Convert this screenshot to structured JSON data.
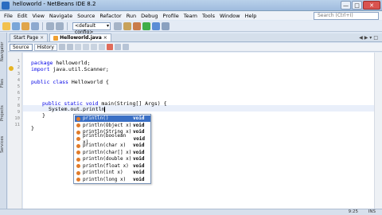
{
  "window": {
    "title": "helloworld - NetBeans IDE 8.2"
  },
  "menu": [
    "File",
    "Edit",
    "View",
    "Navigate",
    "Source",
    "Refactor",
    "Run",
    "Debug",
    "Profile",
    "Team",
    "Tools",
    "Window",
    "Help"
  ],
  "search": {
    "placeholder": "Search (Ctrl+I)"
  },
  "toolbar": {
    "config": "<default config>"
  },
  "side_tabs": [
    "Navigator",
    "Files",
    "Projects",
    "Services"
  ],
  "tabs": [
    {
      "label": "Start Page"
    },
    {
      "label": "Helloworld.java",
      "active": true
    }
  ],
  "source_bar": {
    "source": "Source",
    "history": "History"
  },
  "line_numbers": [
    "1",
    "2",
    "3",
    "4",
    "5",
    "6",
    "7",
    "8",
    "9",
    "10",
    "11"
  ],
  "code": {
    "line1_kw": "package",
    "line1_rest": " helloworld;",
    "line2_kw": "import",
    "line2_rest": " java.util.Scanner;",
    "line3_kw": "public class",
    "line3_rest": " Helloworld {",
    "line4_kw": "public static void",
    "line4_rest": " main(String[] Args) {",
    "line5": "System.out.println",
    "line6": "}",
    "line7": "}"
  },
  "completion": [
    {
      "sig": "println()",
      "type": "void"
    },
    {
      "sig": "println(Object x)",
      "type": "void"
    },
    {
      "sig": "println(String x)",
      "type": "void"
    },
    {
      "sig": "println(boolean x)",
      "type": "void"
    },
    {
      "sig": "println(char x)",
      "type": "void"
    },
    {
      "sig": "println(char[] x)",
      "type": "void"
    },
    {
      "sig": "println(double x)",
      "type": "void"
    },
    {
      "sig": "println(float x)",
      "type": "void"
    },
    {
      "sig": "println(int x)",
      "type": "void"
    },
    {
      "sig": "println(long x)",
      "type": "void"
    }
  ],
  "status": {
    "position": "9:25",
    "mode": "INS"
  },
  "colors": {
    "keyword": "#0000e6",
    "selection": "#3a6fc4",
    "close": "#d9534f"
  }
}
